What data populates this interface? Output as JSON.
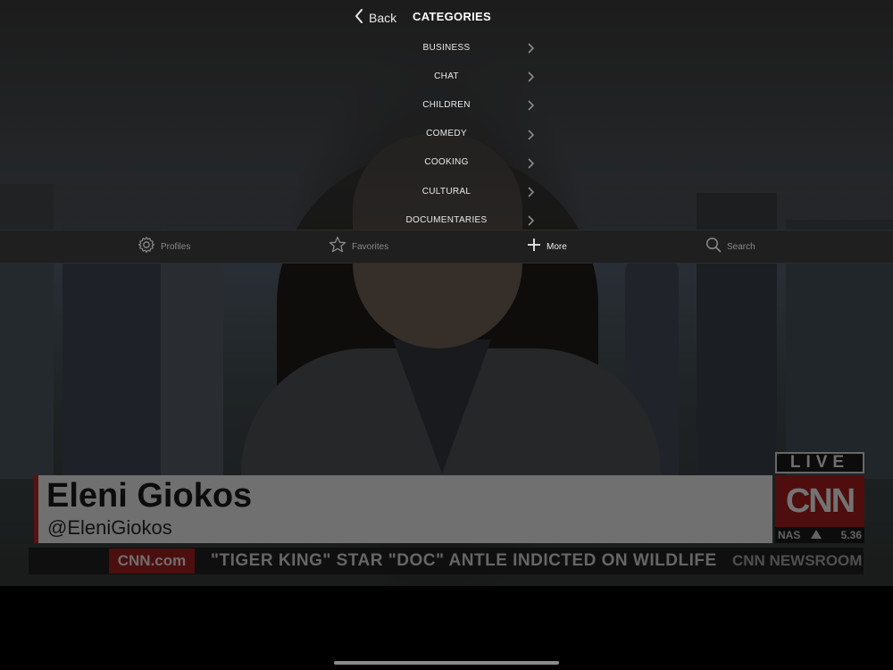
{
  "menu": {
    "back_label": "Back",
    "title": "CATEGORIES",
    "categories": [
      {
        "label": "BUSINESS"
      },
      {
        "label": "CHAT"
      },
      {
        "label": "CHILDREN"
      },
      {
        "label": "COMEDY"
      },
      {
        "label": "COOKING"
      },
      {
        "label": "CULTURAL"
      },
      {
        "label": "DOCUMENTARIES"
      }
    ]
  },
  "tabbar": {
    "tabs": [
      {
        "label": "Profiles",
        "icon": "gear-icon",
        "active": false
      },
      {
        "label": "Favorites",
        "icon": "star-icon",
        "active": false
      },
      {
        "label": "More",
        "icon": "plus-icon",
        "active": true
      },
      {
        "label": "Search",
        "icon": "search-icon",
        "active": false
      }
    ]
  },
  "video": {
    "lower_third": {
      "name": "Eleni Giokos",
      "handle": "@EleniGiokos"
    },
    "ticker": {
      "logo": "CNN.com",
      "headline": "\"TIGER KING\" STAR \"DOC\" ANTLE INDICTED ON WILDLIFE",
      "show": "CNN NEWSROOM"
    },
    "live_label": "LIVE",
    "network_logo": "CNN",
    "stock": {
      "symbol": "NAS",
      "value": "5.36"
    }
  },
  "colors": {
    "tabbar_bg": "#1f1f1f",
    "cnn_red": "#6e1212",
    "menu_text": "#eaeaea"
  }
}
